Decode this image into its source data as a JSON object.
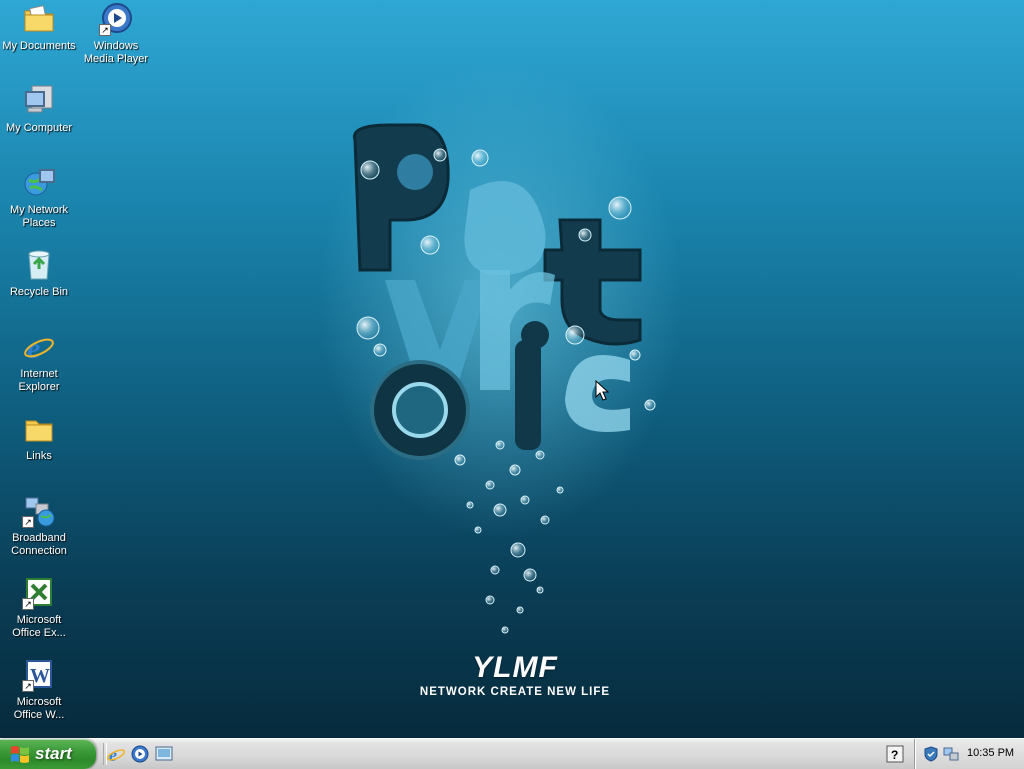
{
  "desktop": {
    "icons": [
      {
        "label": "My Documents"
      },
      {
        "label": "Windows Media Player"
      },
      {
        "label": "My Computer"
      },
      {
        "label": "My Network Places"
      },
      {
        "label": "Recycle Bin"
      },
      {
        "label": "Internet Explorer"
      },
      {
        "label": "Links"
      },
      {
        "label": "Broadband Connection"
      },
      {
        "label": "Microsoft Office Ex..."
      },
      {
        "label": "Microsoft Office W..."
      }
    ]
  },
  "wallpaper": {
    "logo_text": "YLMF",
    "tagline": "NETWORK CREATE NEW LIFE",
    "accent": "#1a84ad"
  },
  "taskbar": {
    "start_label": "start",
    "quick_launch": [
      "internet-explorer-icon",
      "media-player-icon",
      "show-desktop-icon"
    ],
    "clock": "10:35 PM"
  },
  "colors": {
    "start_green": "#3c9b38",
    "taskbar_gray": "#d8d8d8"
  }
}
